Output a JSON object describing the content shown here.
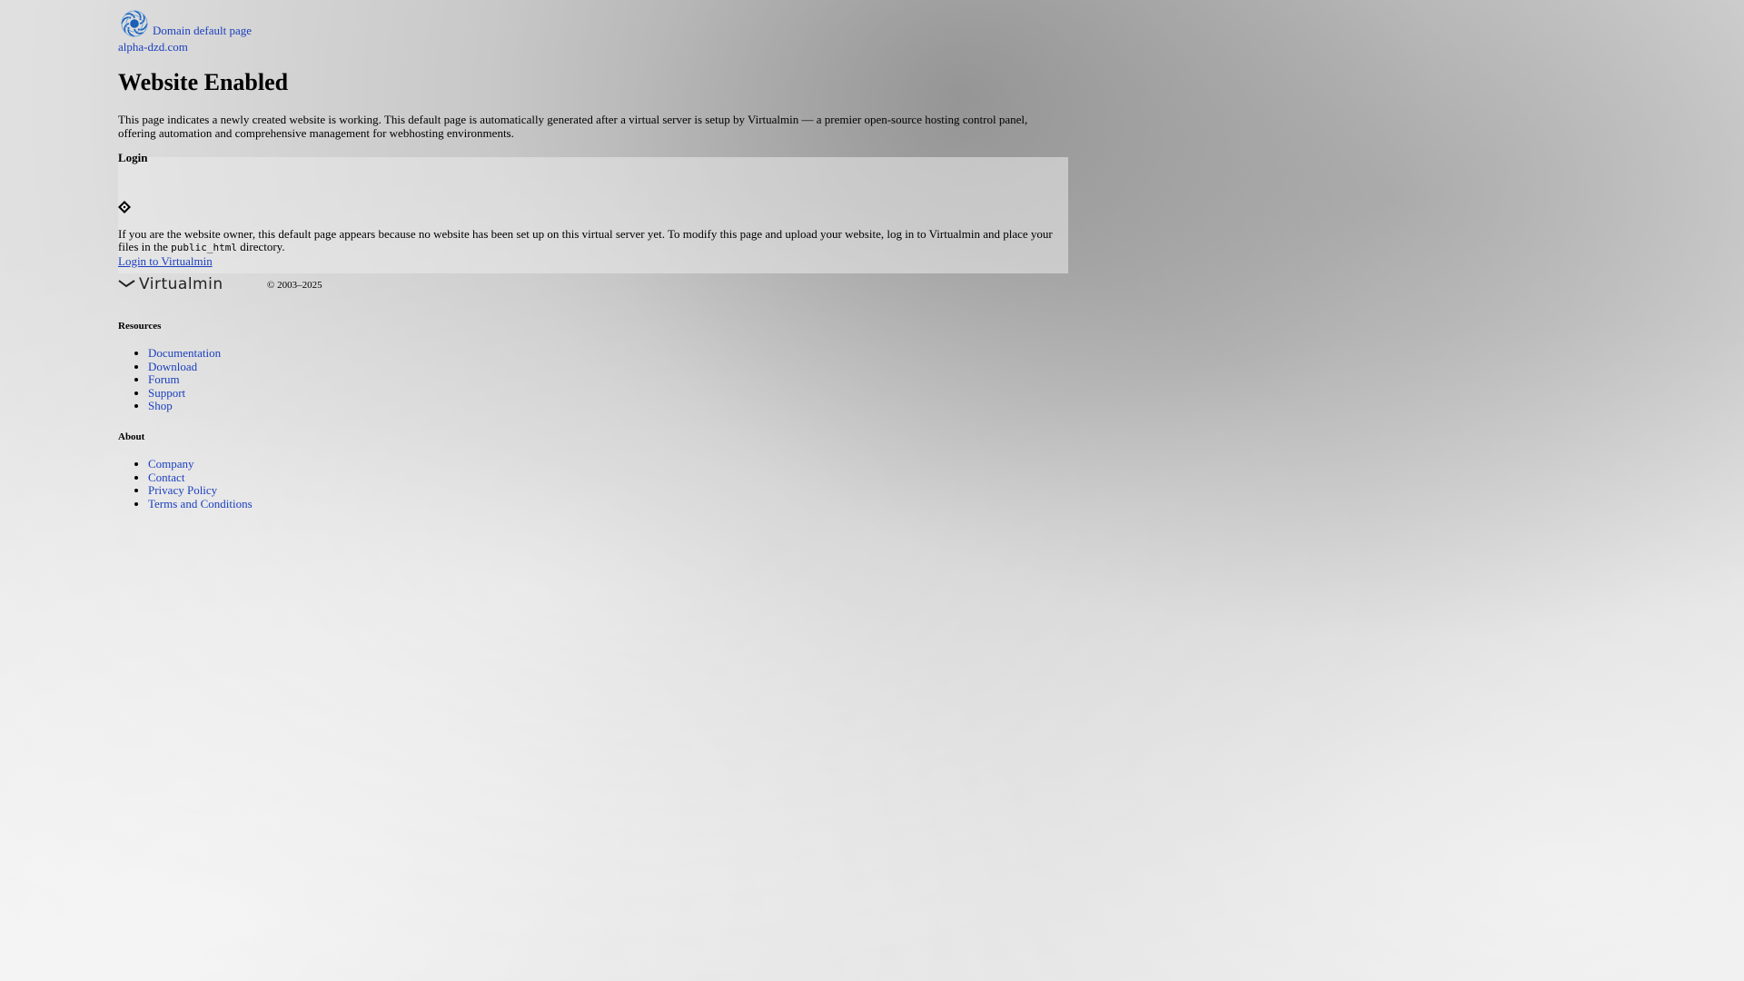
{
  "header": {
    "brand_link": "Domain default page",
    "domain": "alpha-dzd.com",
    "brand_icon": "virtualmin-swirl-icon"
  },
  "main": {
    "title": "Website Enabled",
    "intro": "This page indicates a newly created website is working. This default page is automatically generated after a virtual server is setup by Virtualmin — a premier open-source hosting control panel, offering automation and comprehensive management for webhosting environments.",
    "login": {
      "title": "Login",
      "icon": "diamond-icon",
      "owner_text_before": "If you are the website owner, this default page appears because no website has been set up on this virtual server yet. To modify this page and upload your website, log in to Virtualmin and place your files in the ",
      "owner_code": "public_html",
      "owner_text_after": " directory.",
      "link": "Login to Virtualmin"
    }
  },
  "footer": {
    "logo_text": "Virtualmin",
    "copyright": "© 2003–2025"
  },
  "resources": {
    "title": "Resources",
    "items": [
      "Documentation",
      "Download",
      "Forum",
      "Support",
      "Shop"
    ]
  },
  "about": {
    "title": "About",
    "items": [
      "Company",
      "Contact",
      "Privacy Policy",
      "Terms and Conditions"
    ]
  }
}
